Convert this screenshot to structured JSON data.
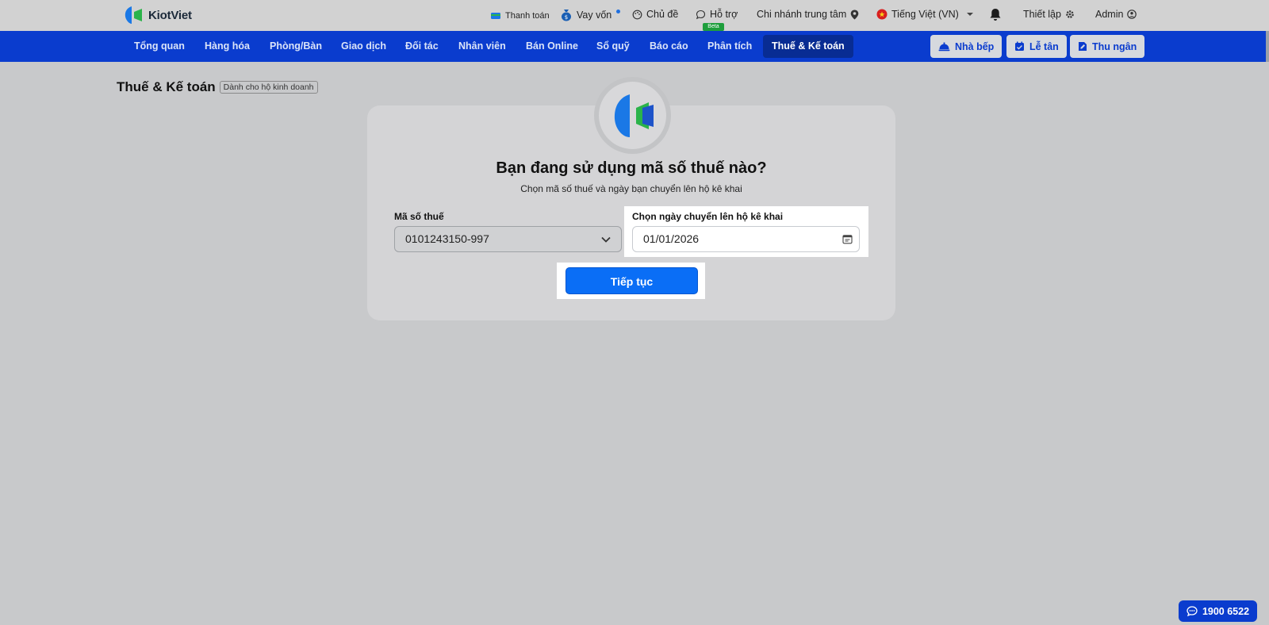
{
  "app": {
    "brand": "KiotViet"
  },
  "topbar": {
    "payment": "Thanh toán",
    "loan": "Vay vốn",
    "theme": "Chủ đề",
    "support": "Hỗ trợ",
    "support_badge": "Beta",
    "branch": "Chi nhánh trung tâm",
    "language": "Tiếng Việt (VN)",
    "settings": "Thiết lập",
    "user": "Admin"
  },
  "nav": {
    "items": [
      {
        "label": "Tổng quan"
      },
      {
        "label": "Hàng hóa"
      },
      {
        "label": "Phòng/Bàn"
      },
      {
        "label": "Giao dịch"
      },
      {
        "label": "Đối tác"
      },
      {
        "label": "Nhân viên"
      },
      {
        "label": "Bán Online"
      },
      {
        "label": "Sổ quỹ"
      },
      {
        "label": "Báo cáo"
      },
      {
        "label": "Phân tích"
      },
      {
        "label": "Thuế & Kế toán"
      }
    ],
    "active_index": 10,
    "buttons": {
      "kitchen": "Nhà bếp",
      "reception": "Lễ tân",
      "cashier": "Thu ngân"
    }
  },
  "page": {
    "title": "Thuế & Kế toán",
    "badge": "Dành cho hộ kinh doanh"
  },
  "card": {
    "heading": "Bạn đang sử dụng mã số thuế nào?",
    "subheading": "Chọn mã số thuế và ngày bạn chuyển lên hộ kê khai",
    "tax_code_label": "Mã số thuế",
    "tax_code_value": "0101243150-997",
    "date_label": "Chọn ngày chuyển lên hộ kê khai",
    "date_value": "01/01/2026",
    "continue_label": "Tiếp tục"
  },
  "hotline": "1900 6522",
  "colors": {
    "nav_bg": "#0a3cce",
    "nav_active": "#082c93",
    "primary": "#0a6ef6",
    "background": "#c8c9cb"
  }
}
